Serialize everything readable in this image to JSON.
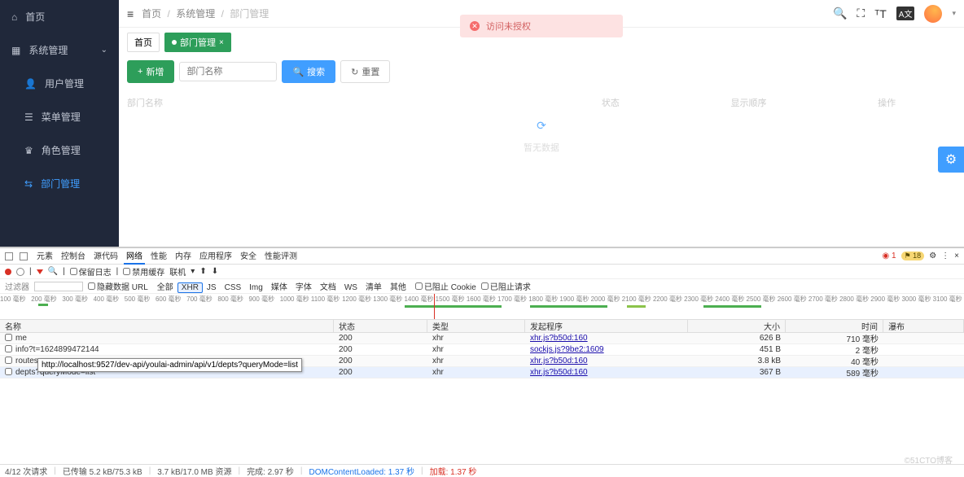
{
  "sidebar": {
    "home": "首页",
    "system": "系统管理",
    "items": [
      "用户管理",
      "菜单管理",
      "角色管理",
      "部门管理"
    ]
  },
  "breadcrumb": [
    "首页",
    "系统管理",
    "部门管理"
  ],
  "tabs": [
    {
      "label": "首页",
      "active": false
    },
    {
      "label": "部门管理",
      "active": true
    }
  ],
  "toolbar": {
    "add": "新增",
    "placeholder": "部门名称",
    "search": "搜索",
    "reset": "重置"
  },
  "table": {
    "headers": [
      "部门名称",
      "状态",
      "显示顺序",
      "操作"
    ],
    "empty": "暂无数据"
  },
  "alert": "访问未授权",
  "devtools": {
    "topTabs": [
      "元素",
      "控制台",
      "源代码",
      "网络",
      "性能",
      "内存",
      "应用程序",
      "安全",
      "性能评测"
    ],
    "warnCount": "1",
    "issueCount": "18",
    "ctrl": {
      "preserve": "保留日志",
      "disable": "禁用缓存",
      "throttle": "联机"
    },
    "filterLabel": "过滤器",
    "hideData": "隐藏数据 URL",
    "types": [
      "全部",
      "XHR",
      "JS",
      "CSS",
      "Img",
      "媒体",
      "字体",
      "文档",
      "WS",
      "清单",
      "其他"
    ],
    "blockedCookie": "已阻止 Cookie",
    "blockedReq": "已阻止请求",
    "ticks": [
      "100 毫秒",
      "200 毫秒",
      "300 毫秒",
      "400 毫秒",
      "500 毫秒",
      "600 毫秒",
      "700 毫秒",
      "800 毫秒",
      "900 毫秒",
      "1000 毫秒",
      "1100 毫秒",
      "1200 毫秒",
      "1300 毫秒",
      "1400 毫秒",
      "1500 毫秒",
      "1600 毫秒",
      "1700 毫秒",
      "1800 毫秒",
      "1900 毫秒",
      "2000 毫秒",
      "2100 毫秒",
      "2200 毫秒",
      "2300 毫秒",
      "2400 毫秒",
      "2500 毫秒",
      "2600 毫秒",
      "2700 毫秒",
      "2800 毫秒",
      "2900 毫秒",
      "3000 毫秒",
      "3100 毫秒"
    ],
    "cols": [
      "名称",
      "状态",
      "类型",
      "发起程序",
      "大小",
      "时间",
      "瀑布"
    ],
    "rows": [
      {
        "name": "me",
        "status": "200",
        "type": "xhr",
        "initiator": "xhr.js?b50d:160",
        "size": "626 B",
        "time": "710 毫秒"
      },
      {
        "name": "info?t=1624899472144",
        "status": "200",
        "type": "xhr",
        "initiator": "sockjs.js?9be2:1609",
        "size": "451 B",
        "time": "2 毫秒"
      },
      {
        "name": "routes",
        "status": "200",
        "type": "xhr",
        "initiator": "xhr.js?b50d:160",
        "size": "3.8 kB",
        "time": "40 毫秒"
      },
      {
        "name": "depts?queryMode=list",
        "status": "200",
        "type": "xhr",
        "initiator": "xhr.js?b50d:160",
        "size": "367 B",
        "time": "589 毫秒"
      }
    ],
    "tooltip": "http://localhost:9527/dev-api/youlai-admin/api/v1/depts?queryMode=list",
    "status": {
      "reqs": "4/12 次请求",
      "trans": "已传输 5.2 kB/75.3 kB",
      "res": "3.7 kB/17.0 MB 资源",
      "finish": "完成: 2.97 秒",
      "dcl": "DOMContentLoaded: 1.37 秒",
      "load": "加载: 1.37 秒"
    }
  },
  "watermark": "©51CTO博客"
}
